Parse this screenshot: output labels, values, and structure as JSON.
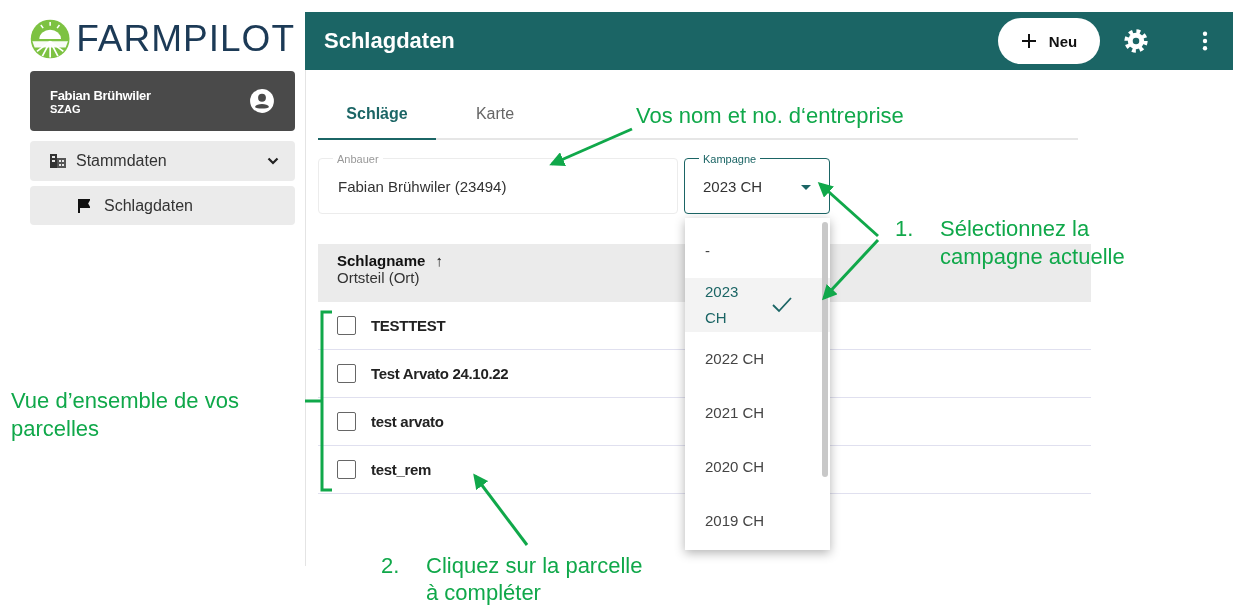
{
  "logo": {
    "text": "FARMPILOT"
  },
  "user": {
    "name": "Fabian Brühwiler",
    "org": "SZAG"
  },
  "nav": [
    {
      "label": "Stammdaten",
      "expanded": true,
      "children": [
        {
          "label": "Schlagdaten"
        }
      ]
    }
  ],
  "header": {
    "title": "Schlagdaten",
    "new_button": "Neu"
  },
  "tabs": [
    {
      "label": "Schläge",
      "selected": true
    },
    {
      "label": "Karte",
      "selected": false
    }
  ],
  "fields": {
    "grower": {
      "label": "Anbauer",
      "value": "Fabian Brühwiler (23494)"
    },
    "campaign": {
      "label": "Kampagne",
      "value": "2023 CH",
      "expanded": true
    }
  },
  "table": {
    "header": {
      "title": "Schlagname",
      "sort": "↑",
      "subtitle": "Ortsteil (Ort)"
    },
    "rows": [
      {
        "name": "TESTTEST",
        "checked": false
      },
      {
        "name": "Test Arvato 24.10.22",
        "checked": false
      },
      {
        "name": "test arvato",
        "checked": false
      },
      {
        "name": "test_rem",
        "checked": false
      }
    ]
  },
  "campaign_menu": [
    {
      "label": "-",
      "selected": false
    },
    {
      "label": "2023 CH",
      "selected": true
    },
    {
      "label": "2022 CH",
      "selected": false
    },
    {
      "label": "2021 CH",
      "selected": false
    },
    {
      "label": "2020 CH",
      "selected": false
    },
    {
      "label": "2019 CH",
      "selected": false
    }
  ],
  "annotations": {
    "grower": "Vos nom et no. d‘entreprise",
    "campaign": {
      "number": "1.",
      "text": "Sélectionnez la\ncampagne actuelle"
    },
    "overview": "Vue d’ensemble de vos\nparcelles",
    "click": {
      "number": "2.",
      "text": "Cliquez sur la parcelle\nà compléter"
    }
  }
}
